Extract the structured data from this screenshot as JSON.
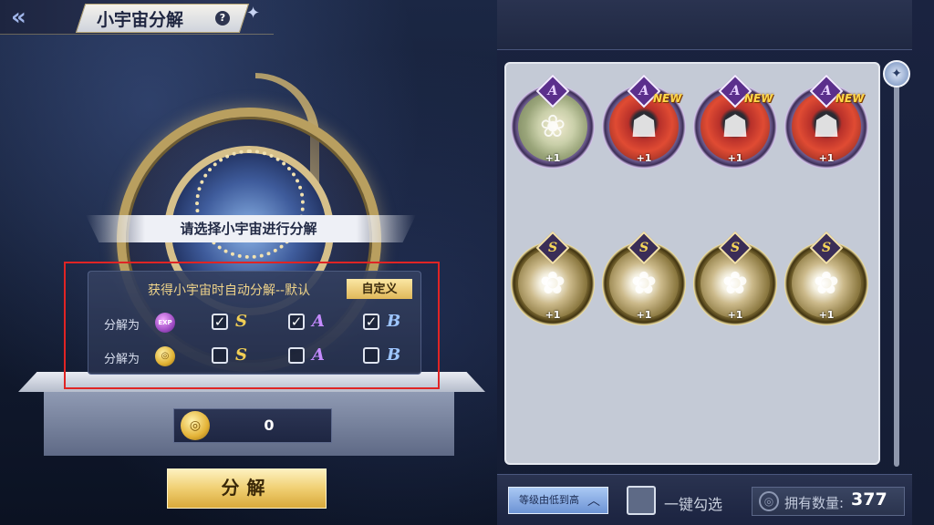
{
  "header": {
    "title": "小宇宙分解",
    "back_symbol": "«",
    "help_symbol": "?"
  },
  "scene": {
    "select_prompt": "请选择小宇宙进行分解"
  },
  "settings": {
    "auto_text": "获得小宇宙时自动分解--默认",
    "custom_button": "自定义",
    "rows": [
      {
        "label": "分解为",
        "resource_icon": "exp-icon",
        "resource_text": "EXP",
        "options": [
          {
            "grade": "S",
            "checked": true
          },
          {
            "grade": "A",
            "checked": true
          },
          {
            "grade": "B",
            "checked": true
          }
        ]
      },
      {
        "label": "分解为",
        "resource_icon": "coin-icon",
        "resource_text": "",
        "options": [
          {
            "grade": "S",
            "checked": false
          },
          {
            "grade": "A",
            "checked": false
          },
          {
            "grade": "B",
            "checked": false
          }
        ]
      }
    ]
  },
  "coin_bar": {
    "count": "0"
  },
  "decompose_button": "分解",
  "inventory": {
    "items": [
      {
        "grade": "A",
        "portrait": "elf",
        "new": false,
        "plus": "+1"
      },
      {
        "grade": "A",
        "portrait": "red-hair",
        "new": true,
        "plus": "+1"
      },
      {
        "grade": "A",
        "portrait": "red-hair",
        "new": true,
        "plus": "+1"
      },
      {
        "grade": "A",
        "portrait": "red-hair",
        "new": true,
        "plus": "+1"
      },
      {
        "grade": "S",
        "portrait": "flower",
        "new": false,
        "plus": "+1"
      },
      {
        "grade": "S",
        "portrait": "flower",
        "new": false,
        "plus": "+1"
      },
      {
        "grade": "S",
        "portrait": "flower",
        "new": false,
        "plus": "+1"
      },
      {
        "grade": "S",
        "portrait": "flower",
        "new": false,
        "plus": "+1"
      }
    ],
    "new_tag": "NEW"
  },
  "bottom_bar": {
    "sort_label": "等级由低到高",
    "select_all_label": "一键勾选",
    "owned_label": "拥有数量:",
    "owned_value": "377"
  },
  "colors": {
    "highlight_box": "#e02424",
    "grade_s": "#f2cf55",
    "grade_a": "#c58bff",
    "grade_b": "#9ec6ff",
    "gold_button": "#f0cf72"
  }
}
